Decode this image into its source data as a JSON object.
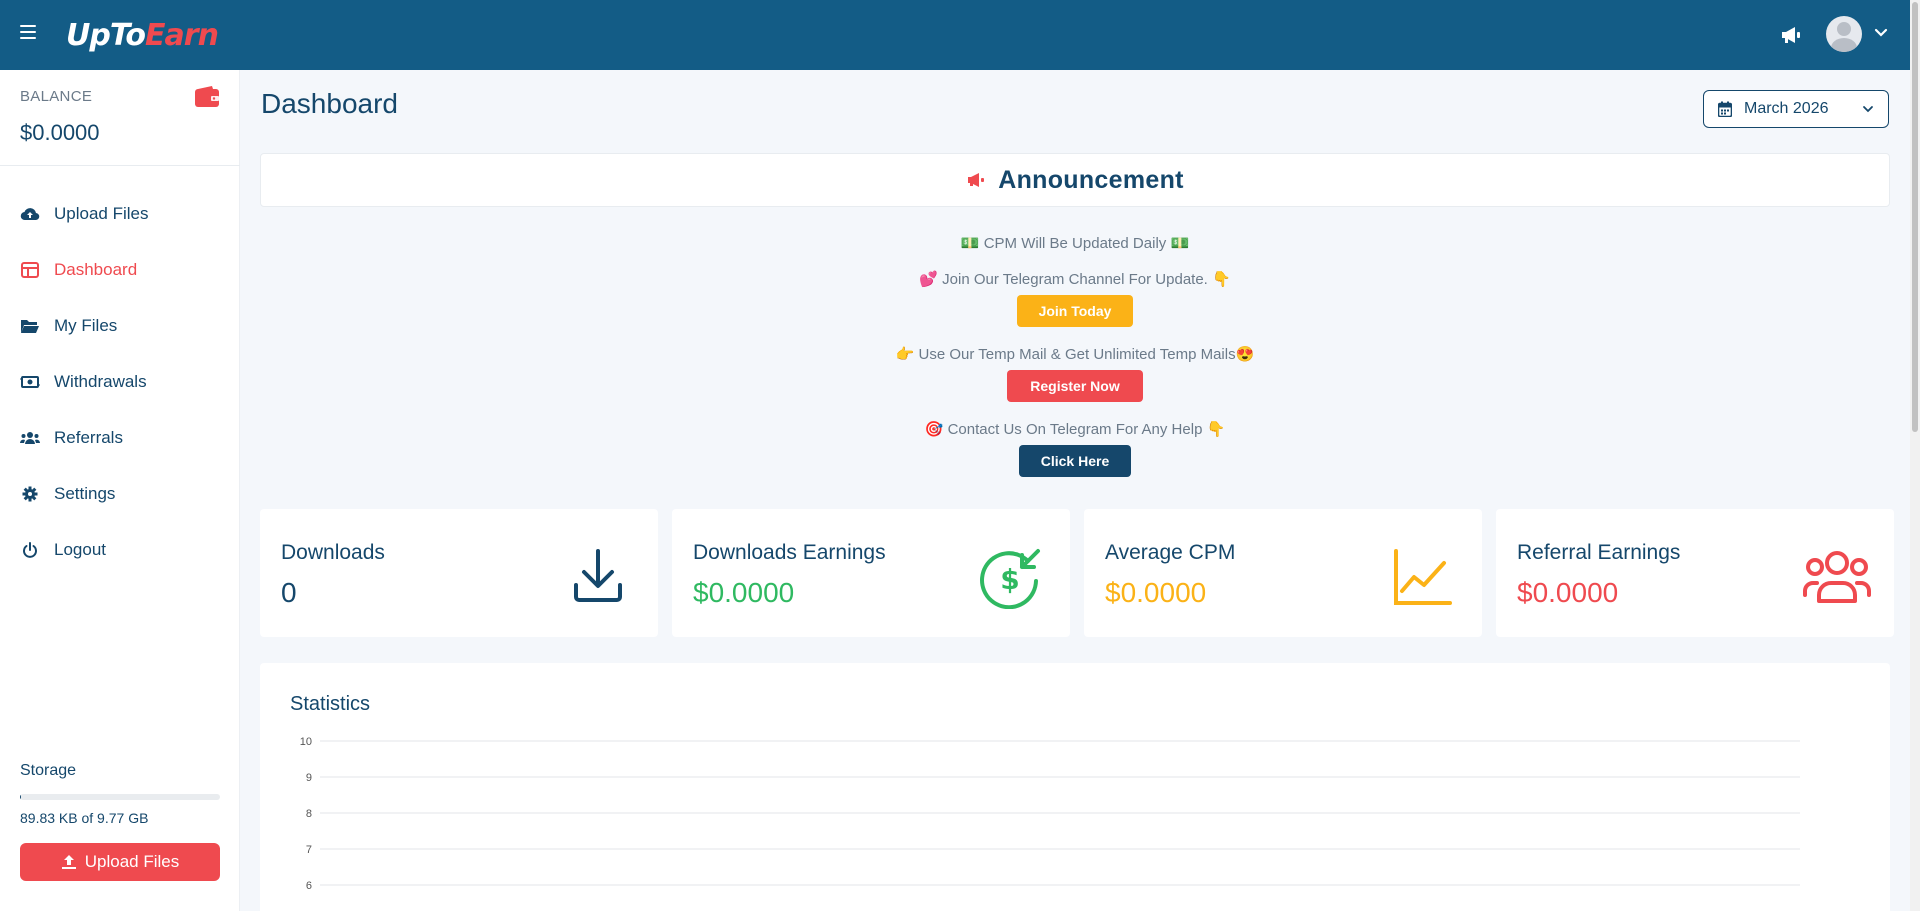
{
  "app": {
    "logo": {
      "part1": "UpTo",
      "part2": "Earn"
    }
  },
  "sidebar": {
    "balance_label": "BALANCE",
    "balance_value": "$0.0000",
    "items": [
      {
        "label": "Upload Files",
        "icon": "cloud-upload-icon",
        "active": false
      },
      {
        "label": "Dashboard",
        "icon": "dashboard-icon",
        "active": true
      },
      {
        "label": "My Files",
        "icon": "folder-open-icon",
        "active": false
      },
      {
        "label": "Withdrawals",
        "icon": "money-icon",
        "active": false
      },
      {
        "label": "Referrals",
        "icon": "users-icon",
        "active": false
      },
      {
        "label": "Settings",
        "icon": "gear-icon",
        "active": false
      },
      {
        "label": "Logout",
        "icon": "power-icon",
        "active": false
      }
    ],
    "storage_label": "Storage",
    "storage_text": "89.83 KB of 9.77 GB",
    "storage_fraction": 1e-05,
    "upload_button": "Upload Files"
  },
  "main": {
    "page_title": "Dashboard",
    "month_picker": "March 2026",
    "announcement": {
      "title": "Announcement",
      "lines": [
        "💵 CPM Will Be Updated Daily 💵",
        "💕 Join Our Telegram Channel For Update. 👇",
        "👉 Use Our Temp Mail & Get Unlimited Temp Mails😍",
        "🎯 Contact Us On Telegram For Any Help 👇"
      ],
      "buttons": {
        "join": "Join Today",
        "register": "Register Now",
        "click": "Click Here"
      }
    },
    "cards": [
      {
        "label": "Downloads",
        "value": "0",
        "color": "#15476b",
        "icon": "download-icon"
      },
      {
        "label": "Downloads Earnings",
        "value": "$0.0000",
        "color": "#2fb961",
        "icon": "dollar-arrow-icon"
      },
      {
        "label": "Average CPM",
        "value": "$0.0000",
        "color": "#fbb217",
        "icon": "line-chart-icon"
      },
      {
        "label": "Referral Earnings",
        "value": "$0.0000",
        "color": "#ef4a4f",
        "icon": "users-group-icon"
      }
    ],
    "statistics_title": "Statistics"
  },
  "chart_data": {
    "type": "line",
    "title": "Statistics",
    "y_ticks": [
      "10",
      "9",
      "8",
      "7",
      "6"
    ],
    "ylim": [
      6,
      10
    ],
    "grid": true,
    "series": []
  },
  "colors": {
    "primary": "#15476b",
    "header": "#135c86",
    "danger": "#ef4a4f",
    "warning": "#fbb217",
    "success": "#2fb961"
  }
}
